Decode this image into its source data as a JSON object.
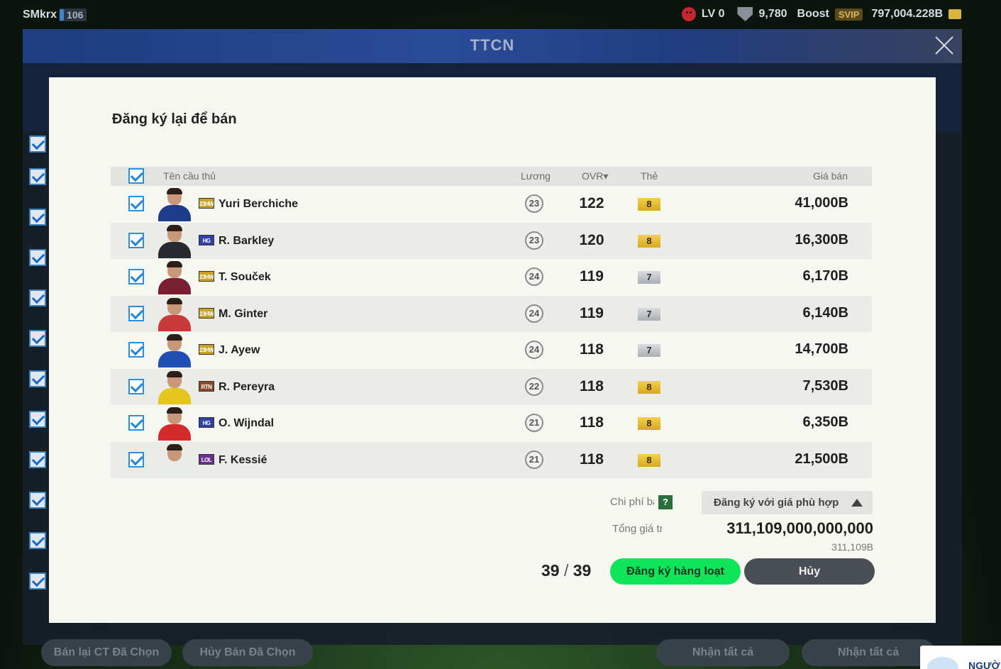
{
  "topbar": {
    "username": "SMkrx",
    "user_level": "106",
    "lv_label": "LV 0",
    "shield_value": "9,780",
    "boost_label": "Boost",
    "svip_label": "SVIP",
    "balance": "797,004.228B"
  },
  "shop": {
    "title": "TTCN",
    "bottom_buttons": [
      "Bán lại CT Đã Chọn",
      "Hủy Bán Đã Chọn",
      "Nhận tất cả",
      "Nhận tất cả"
    ]
  },
  "toast": {
    "label": "NGƯỜ"
  },
  "modal": {
    "title": "Đăng ký lại để bán",
    "columns": {
      "name": "Tên cầu thủ",
      "salary": "Lương",
      "ovr": "OVR▾",
      "grade": "Thẻ",
      "price": "Giá bán"
    },
    "players": [
      {
        "season": "23HW",
        "season_color": "#c9a227",
        "name": "Yuri Berchiche",
        "salary": "23",
        "ovr": "122",
        "grade": "8",
        "grade_type": "gold",
        "price": "41,000B",
        "jersey": "#1f3b8c"
      },
      {
        "season": "HG",
        "season_color": "#2f3fa5",
        "name": "R. Barkley",
        "salary": "23",
        "ovr": "120",
        "grade": "8",
        "grade_type": "gold",
        "price": "16,300B",
        "jersey": "#262a30"
      },
      {
        "season": "23HW",
        "season_color": "#c9a227",
        "name": "T. Souček",
        "salary": "24",
        "ovr": "119",
        "grade": "7",
        "grade_type": "silver",
        "price": "6,170B",
        "jersey": "#7a1f33"
      },
      {
        "season": "23HW",
        "season_color": "#c9a227",
        "name": "M. Ginter",
        "salary": "24",
        "ovr": "119",
        "grade": "7",
        "grade_type": "silver",
        "price": "6,140B",
        "jersey": "#c83a3a"
      },
      {
        "season": "23HW",
        "season_color": "#c9a227",
        "name": "J. Ayew",
        "salary": "24",
        "ovr": "118",
        "grade": "7",
        "grade_type": "silver",
        "price": "14,700B",
        "jersey": "#1f4fb5"
      },
      {
        "season": "RTN",
        "season_color": "#8a4a22",
        "name": "R. Pereyra",
        "salary": "22",
        "ovr": "118",
        "grade": "8",
        "grade_type": "gold",
        "price": "7,530B",
        "jersey": "#e6c51e"
      },
      {
        "season": "HG",
        "season_color": "#2f3fa5",
        "name": "O. Wijndal",
        "salary": "21",
        "ovr": "118",
        "grade": "8",
        "grade_type": "gold",
        "price": "6,350B",
        "jersey": "#d42a2a"
      },
      {
        "season": "LOL",
        "season_color": "#6b2f8f",
        "name": "F. Kessié",
        "salary": "21",
        "ovr": "118",
        "grade": "8",
        "grade_type": "gold",
        "price": "21,500B",
        "jersey": "#e8ece6"
      }
    ],
    "fee_label": "Chi phí bán",
    "dropdown_label": "Đăng ký với giá phù hợp",
    "total_label": "Tổng giá trị",
    "total_full": "311,109,000,000,000",
    "total_short": "311,109B",
    "count_selected": "39",
    "count_total": "39",
    "register_button": "Đăng ký hàng loạt",
    "cancel_button": "Hủy"
  }
}
